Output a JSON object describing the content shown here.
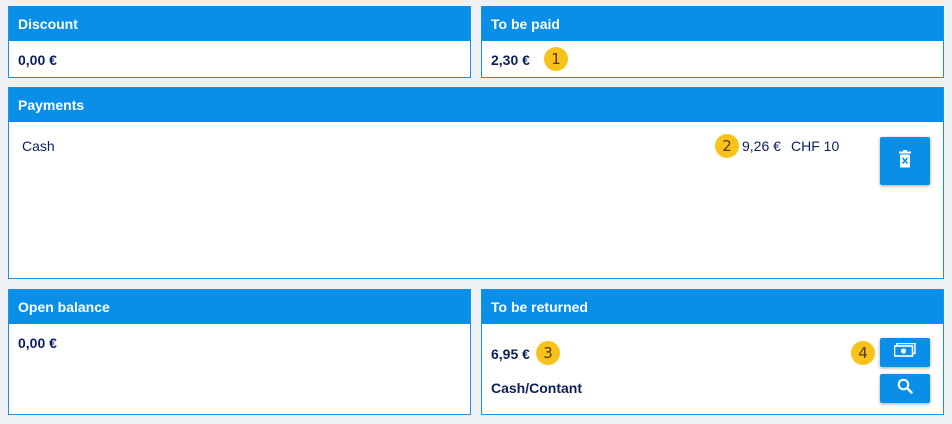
{
  "discount": {
    "label": "Discount",
    "value": "0,00 €"
  },
  "to_be_paid": {
    "label": "To be paid",
    "value": "2,30 €",
    "badge": "1"
  },
  "payments": {
    "label": "Payments",
    "items": [
      {
        "method": "Cash",
        "amount": "9,26 €",
        "currency_note": "CHF 10",
        "badge": "2"
      }
    ]
  },
  "open_balance": {
    "label": "Open balance",
    "value": "0,00 €"
  },
  "to_be_returned": {
    "label": "To be returned",
    "value": "6,95 €",
    "badge": "3",
    "method": "Cash/Contant",
    "cash_button_badge": "4"
  },
  "colors": {
    "header": "#0a8fe8",
    "badge": "#f7c31a",
    "text": "#0b1f5c"
  },
  "icons": {
    "delete": "trash-icon",
    "cash": "banknote-icon",
    "search": "search-icon"
  }
}
